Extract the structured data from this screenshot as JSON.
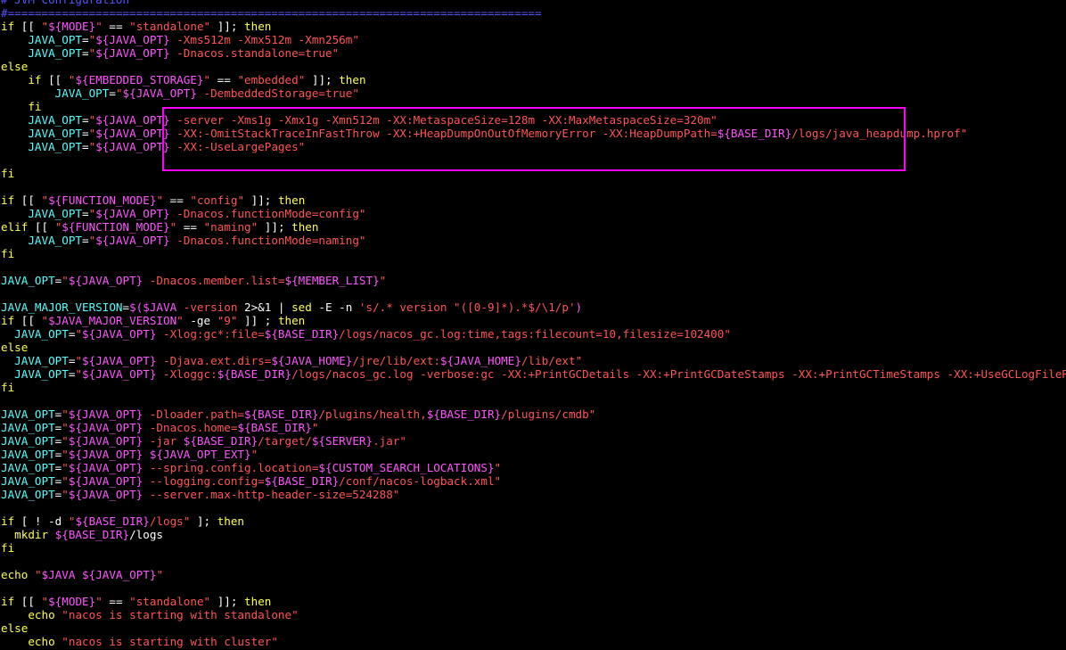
{
  "colors": {
    "background": "#000000",
    "plain": "#ffffff",
    "keyword": "#ffff55",
    "string": "#ff5555",
    "variable": "#ff55ff",
    "comment": "#5555ff",
    "identifier": "#55ffff",
    "highlight_box": "#ff00ff"
  },
  "lines": [
    [
      [
        "cmt",
        "# JVM Configuration"
      ]
    ],
    [
      [
        "cmt",
        "#==============================================================================="
      ]
    ],
    [
      [
        "kw",
        "if"
      ],
      [
        "plain",
        " [[ "
      ],
      [
        "str",
        "\""
      ],
      [
        "var",
        "${MODE}"
      ],
      [
        "str",
        "\""
      ],
      [
        "plain",
        " == "
      ],
      [
        "str",
        "\"standalone\""
      ],
      [
        "plain",
        " ]]; "
      ],
      [
        "kw",
        "then"
      ]
    ],
    [
      [
        "plain",
        "    "
      ],
      [
        "ident",
        "JAVA_OPT"
      ],
      [
        "plain",
        "="
      ],
      [
        "str",
        "\""
      ],
      [
        "var",
        "${JAVA_OPT}"
      ],
      [
        "str",
        " -Xms512m -Xmx512m -Xmn256m\""
      ]
    ],
    [
      [
        "plain",
        "    "
      ],
      [
        "ident",
        "JAVA_OPT"
      ],
      [
        "plain",
        "="
      ],
      [
        "str",
        "\""
      ],
      [
        "var",
        "${JAVA_OPT}"
      ],
      [
        "str",
        " -Dnacos.standalone=true\""
      ]
    ],
    [
      [
        "kw",
        "else"
      ]
    ],
    [
      [
        "plain",
        "    "
      ],
      [
        "kw",
        "if"
      ],
      [
        "plain",
        " [[ "
      ],
      [
        "str",
        "\""
      ],
      [
        "var",
        "${EMBEDDED_STORAGE}"
      ],
      [
        "str",
        "\""
      ],
      [
        "plain",
        " == "
      ],
      [
        "str",
        "\"embedded\""
      ],
      [
        "plain",
        " ]]; "
      ],
      [
        "kw",
        "then"
      ]
    ],
    [
      [
        "plain",
        "        "
      ],
      [
        "ident",
        "JAVA_OPT"
      ],
      [
        "plain",
        "="
      ],
      [
        "str",
        "\""
      ],
      [
        "var",
        "${JAVA_OPT}"
      ],
      [
        "str",
        " -DembeddedStorage=true\""
      ]
    ],
    [
      [
        "plain",
        "    "
      ],
      [
        "kw",
        "fi"
      ]
    ],
    [
      [
        "plain",
        "    "
      ],
      [
        "ident",
        "JAVA_OPT"
      ],
      [
        "plain",
        "="
      ],
      [
        "str",
        "\""
      ],
      [
        "var",
        "${JAVA_OPT}"
      ],
      [
        "str",
        " -server -Xms1g -Xmx1g -Xmn512m -XX:MetaspaceSize=128m -XX:MaxMetaspaceSize=320m\""
      ]
    ],
    [
      [
        "plain",
        "    "
      ],
      [
        "ident",
        "JAVA_OPT"
      ],
      [
        "plain",
        "="
      ],
      [
        "str",
        "\""
      ],
      [
        "var",
        "${JAVA_OPT}"
      ],
      [
        "str",
        " -XX:-OmitStackTraceInFastThrow -XX:+HeapDumpOnOutOfMemoryError -XX:HeapDumpPath="
      ],
      [
        "var",
        "${BASE_DIR}"
      ],
      [
        "str",
        "/logs/java_heapdump.hprof\""
      ]
    ],
    [
      [
        "plain",
        "    "
      ],
      [
        "ident",
        "JAVA_OPT"
      ],
      [
        "plain",
        "="
      ],
      [
        "str",
        "\""
      ],
      [
        "var",
        "${JAVA_OPT}"
      ],
      [
        "str",
        " -XX:-UseLargePages\""
      ]
    ],
    [],
    [
      [
        "kw",
        "fi"
      ]
    ],
    [],
    [
      [
        "kw",
        "if"
      ],
      [
        "plain",
        " [[ "
      ],
      [
        "str",
        "\""
      ],
      [
        "var",
        "${FUNCTION_MODE}"
      ],
      [
        "str",
        "\""
      ],
      [
        "plain",
        " == "
      ],
      [
        "str",
        "\"config\""
      ],
      [
        "plain",
        " ]]; "
      ],
      [
        "kw",
        "then"
      ]
    ],
    [
      [
        "plain",
        "    "
      ],
      [
        "ident",
        "JAVA_OPT"
      ],
      [
        "plain",
        "="
      ],
      [
        "str",
        "\""
      ],
      [
        "var",
        "${JAVA_OPT}"
      ],
      [
        "str",
        " -Dnacos.functionMode=config\""
      ]
    ],
    [
      [
        "kw",
        "elif"
      ],
      [
        "plain",
        " [[ "
      ],
      [
        "str",
        "\""
      ],
      [
        "var",
        "${FUNCTION_MODE}"
      ],
      [
        "str",
        "\""
      ],
      [
        "plain",
        " == "
      ],
      [
        "str",
        "\"naming\""
      ],
      [
        "plain",
        " ]]; "
      ],
      [
        "kw",
        "then"
      ]
    ],
    [
      [
        "plain",
        "    "
      ],
      [
        "ident",
        "JAVA_OPT"
      ],
      [
        "plain",
        "="
      ],
      [
        "str",
        "\""
      ],
      [
        "var",
        "${JAVA_OPT}"
      ],
      [
        "str",
        " -Dnacos.functionMode=naming\""
      ]
    ],
    [
      [
        "kw",
        "fi"
      ]
    ],
    [],
    [
      [
        "ident",
        "JAVA_OPT"
      ],
      [
        "plain",
        "="
      ],
      [
        "str",
        "\""
      ],
      [
        "var",
        "${JAVA_OPT}"
      ],
      [
        "str",
        " -Dnacos.member.list="
      ],
      [
        "var",
        "${MEMBER_LIST}"
      ],
      [
        "str",
        "\""
      ]
    ],
    [],
    [
      [
        "ident",
        "JAVA_MAJOR_VERSION"
      ],
      [
        "plain",
        "="
      ],
      [
        "var",
        "$($JAVA"
      ],
      [
        "str",
        " -version "
      ],
      [
        "plain",
        "2>&1"
      ],
      [
        "plain",
        " | "
      ],
      [
        "kw",
        "sed"
      ],
      [
        "plain",
        " -E -n "
      ],
      [
        "str",
        "'s/.* version \"([0-9]*).*$/\\1/p'"
      ],
      [
        "var",
        ")"
      ]
    ],
    [
      [
        "kw",
        "if"
      ],
      [
        "plain",
        " [[ "
      ],
      [
        "str",
        "\""
      ],
      [
        "var",
        "$JAVA_MAJOR_VERSION"
      ],
      [
        "str",
        "\""
      ],
      [
        "plain",
        " -ge "
      ],
      [
        "str",
        "\"9\""
      ],
      [
        "plain",
        " ]] ; "
      ],
      [
        "kw",
        "then"
      ]
    ],
    [
      [
        "plain",
        "  "
      ],
      [
        "ident",
        "JAVA_OPT"
      ],
      [
        "plain",
        "="
      ],
      [
        "str",
        "\""
      ],
      [
        "var",
        "${JAVA_OPT}"
      ],
      [
        "str",
        " -Xlog:gc*:file="
      ],
      [
        "var",
        "${BASE_DIR}"
      ],
      [
        "str",
        "/logs/nacos_gc.log:time,tags:filecount=10,filesize=102400\""
      ]
    ],
    [
      [
        "kw",
        "else"
      ]
    ],
    [
      [
        "plain",
        "  "
      ],
      [
        "ident",
        "JAVA_OPT"
      ],
      [
        "plain",
        "="
      ],
      [
        "str",
        "\""
      ],
      [
        "var",
        "${JAVA_OPT}"
      ],
      [
        "str",
        " -Djava.ext.dirs="
      ],
      [
        "var",
        "${JAVA_HOME}"
      ],
      [
        "str",
        "/jre/lib/ext:"
      ],
      [
        "var",
        "${JAVA_HOME}"
      ],
      [
        "str",
        "/lib/ext\""
      ]
    ],
    [
      [
        "plain",
        "  "
      ],
      [
        "ident",
        "JAVA_OPT"
      ],
      [
        "plain",
        "="
      ],
      [
        "str",
        "\""
      ],
      [
        "var",
        "${JAVA_OPT}"
      ],
      [
        "str",
        " -Xloggc:"
      ],
      [
        "var",
        "${BASE_DIR}"
      ],
      [
        "str",
        "/logs/nacos_gc.log -verbose:gc -XX:+PrintGCDetails -XX:+PrintGCDateStamps -XX:+PrintGCTimeStamps -XX:+UseGCLogFileRotation -XX:N"
      ]
    ],
    [
      [
        "kw",
        "fi"
      ]
    ],
    [],
    [
      [
        "ident",
        "JAVA_OPT"
      ],
      [
        "plain",
        "="
      ],
      [
        "str",
        "\""
      ],
      [
        "var",
        "${JAVA_OPT}"
      ],
      [
        "str",
        " -Dloader.path="
      ],
      [
        "var",
        "${BASE_DIR}"
      ],
      [
        "str",
        "/plugins/health,"
      ],
      [
        "var",
        "${BASE_DIR}"
      ],
      [
        "str",
        "/plugins/cmdb\""
      ]
    ],
    [
      [
        "ident",
        "JAVA_OPT"
      ],
      [
        "plain",
        "="
      ],
      [
        "str",
        "\""
      ],
      [
        "var",
        "${JAVA_OPT}"
      ],
      [
        "str",
        " -Dnacos.home="
      ],
      [
        "var",
        "${BASE_DIR}"
      ],
      [
        "str",
        "\""
      ]
    ],
    [
      [
        "ident",
        "JAVA_OPT"
      ],
      [
        "plain",
        "="
      ],
      [
        "str",
        "\""
      ],
      [
        "var",
        "${JAVA_OPT}"
      ],
      [
        "str",
        " -jar "
      ],
      [
        "var",
        "${BASE_DIR}"
      ],
      [
        "str",
        "/target/"
      ],
      [
        "var",
        "${SERVER}"
      ],
      [
        "str",
        ".jar\""
      ]
    ],
    [
      [
        "ident",
        "JAVA_OPT"
      ],
      [
        "plain",
        "="
      ],
      [
        "str",
        "\""
      ],
      [
        "var",
        "${JAVA_OPT}"
      ],
      [
        "str",
        " "
      ],
      [
        "var",
        "${JAVA_OPT_EXT}"
      ],
      [
        "str",
        "\""
      ]
    ],
    [
      [
        "ident",
        "JAVA_OPT"
      ],
      [
        "plain",
        "="
      ],
      [
        "str",
        "\""
      ],
      [
        "var",
        "${JAVA_OPT}"
      ],
      [
        "str",
        " --spring.config.location="
      ],
      [
        "var",
        "${CUSTOM_SEARCH_LOCATIONS}"
      ],
      [
        "str",
        "\""
      ]
    ],
    [
      [
        "ident",
        "JAVA_OPT"
      ],
      [
        "plain",
        "="
      ],
      [
        "str",
        "\""
      ],
      [
        "var",
        "${JAVA_OPT}"
      ],
      [
        "str",
        " --logging.config="
      ],
      [
        "var",
        "${BASE_DIR}"
      ],
      [
        "str",
        "/conf/nacos-logback.xml\""
      ]
    ],
    [
      [
        "ident",
        "JAVA_OPT"
      ],
      [
        "plain",
        "="
      ],
      [
        "str",
        "\""
      ],
      [
        "var",
        "${JAVA_OPT}"
      ],
      [
        "str",
        " --server.max-http-header-size=524288\""
      ]
    ],
    [],
    [
      [
        "kw",
        "if"
      ],
      [
        "plain",
        " [ ! -d "
      ],
      [
        "str",
        "\""
      ],
      [
        "var",
        "${BASE_DIR}"
      ],
      [
        "str",
        "/logs\""
      ],
      [
        "plain",
        " ]; "
      ],
      [
        "kw",
        "then"
      ]
    ],
    [
      [
        "plain",
        "  "
      ],
      [
        "kw",
        "mkdir"
      ],
      [
        "plain",
        " "
      ],
      [
        "var",
        "${BASE_DIR}"
      ],
      [
        "plain",
        "/logs"
      ]
    ],
    [
      [
        "kw",
        "fi"
      ]
    ],
    [],
    [
      [
        "kw",
        "echo"
      ],
      [
        "plain",
        " "
      ],
      [
        "str",
        "\""
      ],
      [
        "var",
        "$JAVA ${JAVA_OPT}"
      ],
      [
        "str",
        "\""
      ]
    ],
    [],
    [
      [
        "kw",
        "if"
      ],
      [
        "plain",
        " [[ "
      ],
      [
        "str",
        "\""
      ],
      [
        "var",
        "${MODE}"
      ],
      [
        "str",
        "\""
      ],
      [
        "plain",
        " == "
      ],
      [
        "str",
        "\"standalone\""
      ],
      [
        "plain",
        " ]]; "
      ],
      [
        "kw",
        "then"
      ]
    ],
    [
      [
        "plain",
        "    "
      ],
      [
        "kw",
        "echo"
      ],
      [
        "plain",
        " "
      ],
      [
        "str",
        "\"nacos is starting with standalone\""
      ]
    ],
    [
      [
        "kw",
        "else"
      ]
    ],
    [
      [
        "plain",
        "    "
      ],
      [
        "kw",
        "echo"
      ],
      [
        "plain",
        " "
      ],
      [
        "str",
        "\"nacos is starting with cluster\""
      ]
    ]
  ]
}
